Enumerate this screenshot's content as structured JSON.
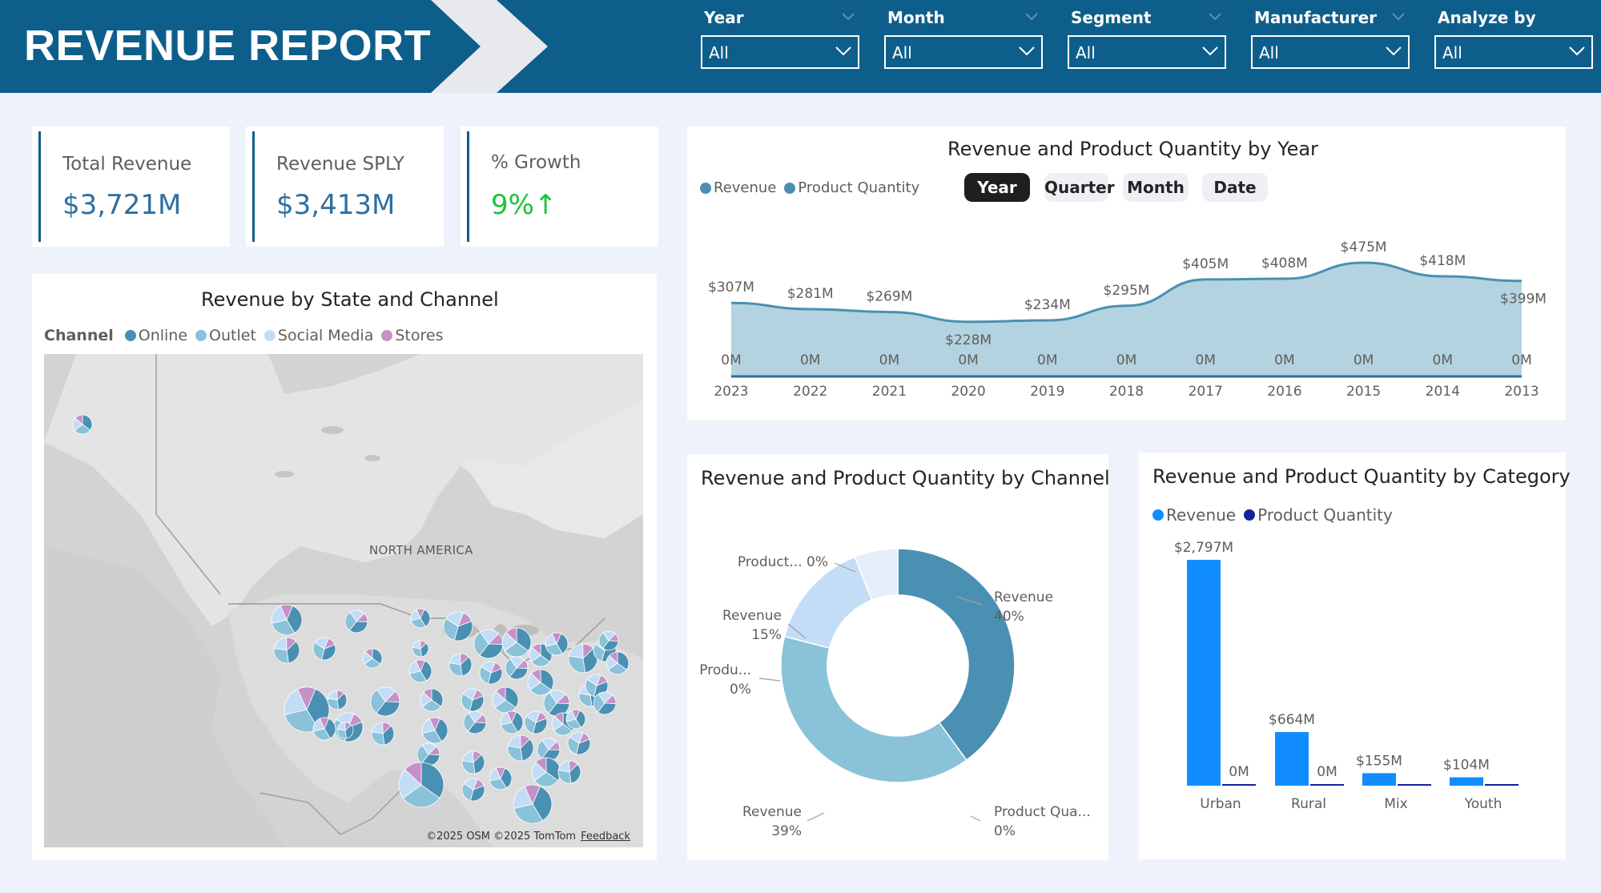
{
  "header": {
    "title": "REVENUE REPORT",
    "filters": [
      {
        "label": "Year",
        "value": "All"
      },
      {
        "label": "Month",
        "value": "All"
      },
      {
        "label": "Segment",
        "value": "All"
      },
      {
        "label": "Manufacturer",
        "value": "All"
      },
      {
        "label": "Analyze by",
        "value": "All"
      }
    ]
  },
  "kpis": [
    {
      "label": "Total Revenue",
      "value": "$3,721M"
    },
    {
      "label": "Revenue SPLY",
      "value": "$3,413M"
    },
    {
      "label": "% Growth",
      "value": "9%↑"
    }
  ],
  "map_visual": {
    "title": "Revenue by State and Channel",
    "legend_title": "Channel",
    "legend": [
      {
        "name": "Online",
        "color": "#4a90b2"
      },
      {
        "name": "Outlet",
        "color": "#89c2d9"
      },
      {
        "name": "Social Media",
        "color": "#c4ddf6"
      },
      {
        "name": "Stores",
        "color": "#c690c8"
      }
    ],
    "region_label": "NORTH AMERICA",
    "credits": "©2025 OSM  ©2025 TomTom",
    "feedback": "Feedback"
  },
  "year_visual": {
    "title": "Revenue and Product Quantity by Year",
    "legend": [
      {
        "name": "Revenue",
        "color": "#4a90b2"
      },
      {
        "name": "Product Quantity",
        "color": "#4a90b2"
      }
    ],
    "period_buttons": [
      "Year",
      "Quarter",
      "Month",
      "Date"
    ],
    "active_period": "Year"
  },
  "channel_visual": {
    "title": "Revenue and Product Quantity by Channel"
  },
  "category_visual": {
    "title": "Revenue and Product Quantity by Category",
    "legend": [
      {
        "name": "Revenue",
        "color": "#118dff"
      },
      {
        "name": "Product Quantity",
        "color": "#12239e"
      }
    ]
  },
  "chart_data": [
    {
      "type": "area",
      "title": "Revenue and Product Quantity by Year",
      "categories": [
        "2023",
        "2022",
        "2021",
        "2020",
        "2019",
        "2018",
        "2017",
        "2016",
        "2015",
        "2014",
        "2013"
      ],
      "series": [
        {
          "name": "Revenue",
          "values": [
            307,
            281,
            269,
            228,
            234,
            295,
            405,
            408,
            475,
            418,
            399
          ],
          "labels": [
            "$307M",
            "$281M",
            "$269M",
            "$228M",
            "$234M",
            "$295M",
            "$405M",
            "$408M",
            "$475M",
            "$418M",
            "$399M"
          ]
        },
        {
          "name": "Product Quantity",
          "values": [
            0,
            0,
            0,
            0,
            0,
            0,
            0,
            0,
            0,
            0,
            0
          ],
          "labels": [
            "0M",
            "0M",
            "0M",
            "0M",
            "0M",
            "0M",
            "0M",
            "0M",
            "0M",
            "0M",
            "0M"
          ]
        }
      ],
      "ylim": [
        0,
        475
      ],
      "legend": "top-left"
    },
    {
      "type": "pie",
      "title": "Revenue and Product Quantity by Channel",
      "slices": [
        {
          "label": "Revenue",
          "pct": "40%",
          "value": 40,
          "color": "#4a90b2"
        },
        {
          "label": "Product Qua...",
          "pct": "0%",
          "value": 0,
          "color": "#2e6fa0"
        },
        {
          "label": "Revenue",
          "pct": "39%",
          "value": 39,
          "color": "#89c2d9"
        },
        {
          "label": "Produ...",
          "pct": "0%",
          "value": 0,
          "color": "#6aaccd"
        },
        {
          "label": "Revenue",
          "pct": "15%",
          "value": 15,
          "color": "#c4ddf6"
        },
        {
          "label": "Product...",
          "pct": "0%",
          "value": 0,
          "color": "#a9cbe9"
        },
        {
          "label": "",
          "pct": "",
          "value": 6,
          "color": "#e6eef9"
        }
      ]
    },
    {
      "type": "bar",
      "title": "Revenue and Product Quantity by Category",
      "categories": [
        "Urban",
        "Rural",
        "Mix",
        "Youth"
      ],
      "series": [
        {
          "name": "Revenue",
          "values": [
            2797,
            664,
            155,
            104
          ],
          "labels": [
            "$2,797M",
            "$664M",
            "$155M",
            "$104M"
          ]
        },
        {
          "name": "Product Quantity",
          "values": [
            0,
            0,
            0,
            0
          ],
          "labels": [
            "0M",
            "0M",
            "",
            ""
          ]
        }
      ],
      "ylim": [
        0,
        2797
      ],
      "legend": "top-left"
    }
  ]
}
